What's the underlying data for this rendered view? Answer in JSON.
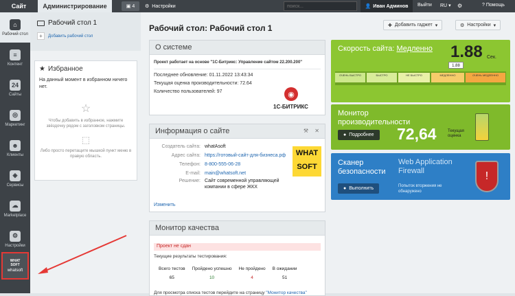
{
  "topbar": {
    "site": "Сайт",
    "admin": "Администрирование",
    "notif_count": "4",
    "settings": "Настройки",
    "search_placeholder": "поиск...",
    "user": "Иван Админов",
    "exit": "Выйти",
    "lang": "RU",
    "help": "Помощь"
  },
  "nav": [
    {
      "label": "Рабочий стол",
      "icon": "home-icon"
    },
    {
      "label": "Контент",
      "icon": "document-icon"
    },
    {
      "label": "Сайты",
      "icon": "calendar-icon"
    },
    {
      "label": "Маркетинг",
      "icon": "target-icon"
    },
    {
      "label": "Клиенты",
      "icon": "users-icon"
    },
    {
      "label": "Сервисы",
      "icon": "layers-icon"
    },
    {
      "label": "Marketplace",
      "icon": "cloud-download-icon"
    },
    {
      "label": "Настройки",
      "icon": "gear-icon"
    },
    {
      "label": "whatsoft",
      "icon": "whatsoft-logo-icon"
    }
  ],
  "sidebar": {
    "desktop": "Рабочий стол 1",
    "add_desktop": "Добавить рабочий стол",
    "fav_title": "Избранное",
    "fav_empty": "На данный момент в избранном ничего нет.",
    "fav_hint1": "Чтобы добавить в избранное, нажмите звёздочку рядом с заголовком страницы.",
    "fav_hint2": "Либо просто перетащите мышкой пункт меню в правую область."
  },
  "main": {
    "title": "Рабочий стол: Рабочий стол 1",
    "add_gadget": "Добавить гаджет",
    "settings": "Настройки"
  },
  "about": {
    "title": "О системе",
    "project": "Проект работает на основе \"1С-Битрикс: Управление сайтом 22.200.200\"",
    "updated": "Последнее обновление: 01.11.2022 13:43:34",
    "perf": "Текущая оценка производительности: 72.64",
    "users": "Количество пользователей: 97",
    "logo": "1С-БИТРИКС"
  },
  "info": {
    "title": "Информация о сайте",
    "rows": [
      {
        "k": "Создатель сайта:",
        "v": "whatAsoft"
      },
      {
        "k": "Адрес сайта:",
        "v": "https://готовый-сайт-для-бизнеса.рф"
      },
      {
        "k": "Телефон:",
        "v": "8-800-555-06-28"
      },
      {
        "k": "E-mail:",
        "v": "main@whatsoft.net"
      },
      {
        "k": "Решение:",
        "v": "Сайт современной управляющей компании в сфере ЖКХ"
      }
    ],
    "logo_top": "WHAT",
    "logo_bottom": "SOFT",
    "edit": "Изменить"
  },
  "quality": {
    "title": "Монитор качества",
    "status": "Проект не сдан",
    "results": "Текущие результаты тестирования:",
    "headers": [
      "Всего тестов",
      "Пройдено успешно",
      "Не пройдено",
      "В ожидании"
    ],
    "values": [
      "65",
      "10",
      "4",
      "51"
    ],
    "footer": "Для просмотра списка тестов перейдите на страницу",
    "footer_link": "\"Монитор качества\""
  },
  "speed": {
    "title": "Скорость сайта:",
    "status": "Медленно",
    "value": "1.88",
    "unit": "Сек.",
    "marker": "1.88",
    "segments": [
      "ОЧЕНЬ БЫСТРО",
      "БЫСТРО",
      "НЕ БЫСТРО",
      "МЕДЛЕННО",
      "ОЧЕНЬ МЕДЛЕННО"
    ]
  },
  "monitor": {
    "title": "Монитор производительности",
    "button": "Подробнее",
    "value": "72,64",
    "caption": "Текущая оценка"
  },
  "scan": {
    "title": "Сканер безопасности",
    "subtitle": "Web Application Firewall",
    "button": "Выполнить",
    "caption": "Попыток вторжения не обнаружено"
  },
  "colors": {
    "topbar": "#3d4247",
    "speed": "#8cc631",
    "monitor": "#7fba2b",
    "scan": "#2e7fc6",
    "highlight": "#e53935"
  }
}
